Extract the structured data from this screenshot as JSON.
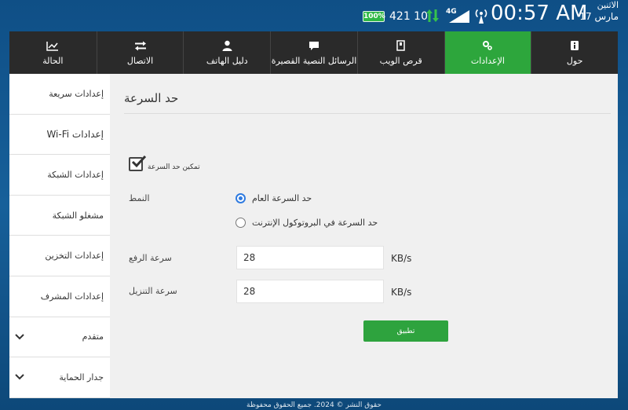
{
  "status": {
    "battery": "100%",
    "traffic": "421 10",
    "network": "4G",
    "time": "00:57 AM",
    "weekday": "الاثنين",
    "date": "مارس 17"
  },
  "nav": {
    "tabs": [
      {
        "label": "حول",
        "icon": "info-doc-icon"
      },
      {
        "label": "الإعدادات",
        "icon": "gears-icon",
        "active": true
      },
      {
        "label": "قرص الويب",
        "icon": "sd-card-icon"
      },
      {
        "label": "الرسائل النصية القصيرة",
        "icon": "chat-bubble-icon"
      },
      {
        "label": "دليل الهاتف",
        "icon": "person-icon"
      },
      {
        "label": "الاتصال",
        "icon": "swap-arrows-icon"
      },
      {
        "label": "الحالة",
        "icon": "chart-line-icon"
      }
    ]
  },
  "sidebar": {
    "items": [
      {
        "label": "إعدادات سريعة"
      },
      {
        "label": "إعدادات Wi-Fi"
      },
      {
        "label": "إعدادات الشبكة"
      },
      {
        "label": "مشغلو الشبكة"
      },
      {
        "label": "إعدادات التخزين"
      },
      {
        "label": "إعدادات المشرف"
      },
      {
        "label": "متقدم",
        "expandable": true
      },
      {
        "label": "جدار الحماية",
        "expandable": true
      }
    ]
  },
  "form": {
    "title": "حد السرعة",
    "enable_label": "تمكين حد السرعة",
    "enable_checked": true,
    "mode_label": "النمط",
    "mode_options": [
      "حد السرعة العام",
      "حد السرعة في البروتوكول الإنترنت"
    ],
    "mode_selected": 0,
    "upload_label": "سرعة الرفع",
    "upload_value": "28",
    "download_label": "سرعة التنزيل",
    "download_value": "28",
    "unit": "KB/s",
    "apply_label": "تطبيق"
  },
  "footer": {
    "text": "حقوق النشر © 2024. جميع الحقوق محفوظة"
  },
  "colors": {
    "accent": "#2da63c",
    "nav_bg": "#2a2a2a",
    "radio_on": "#2f7be0"
  }
}
